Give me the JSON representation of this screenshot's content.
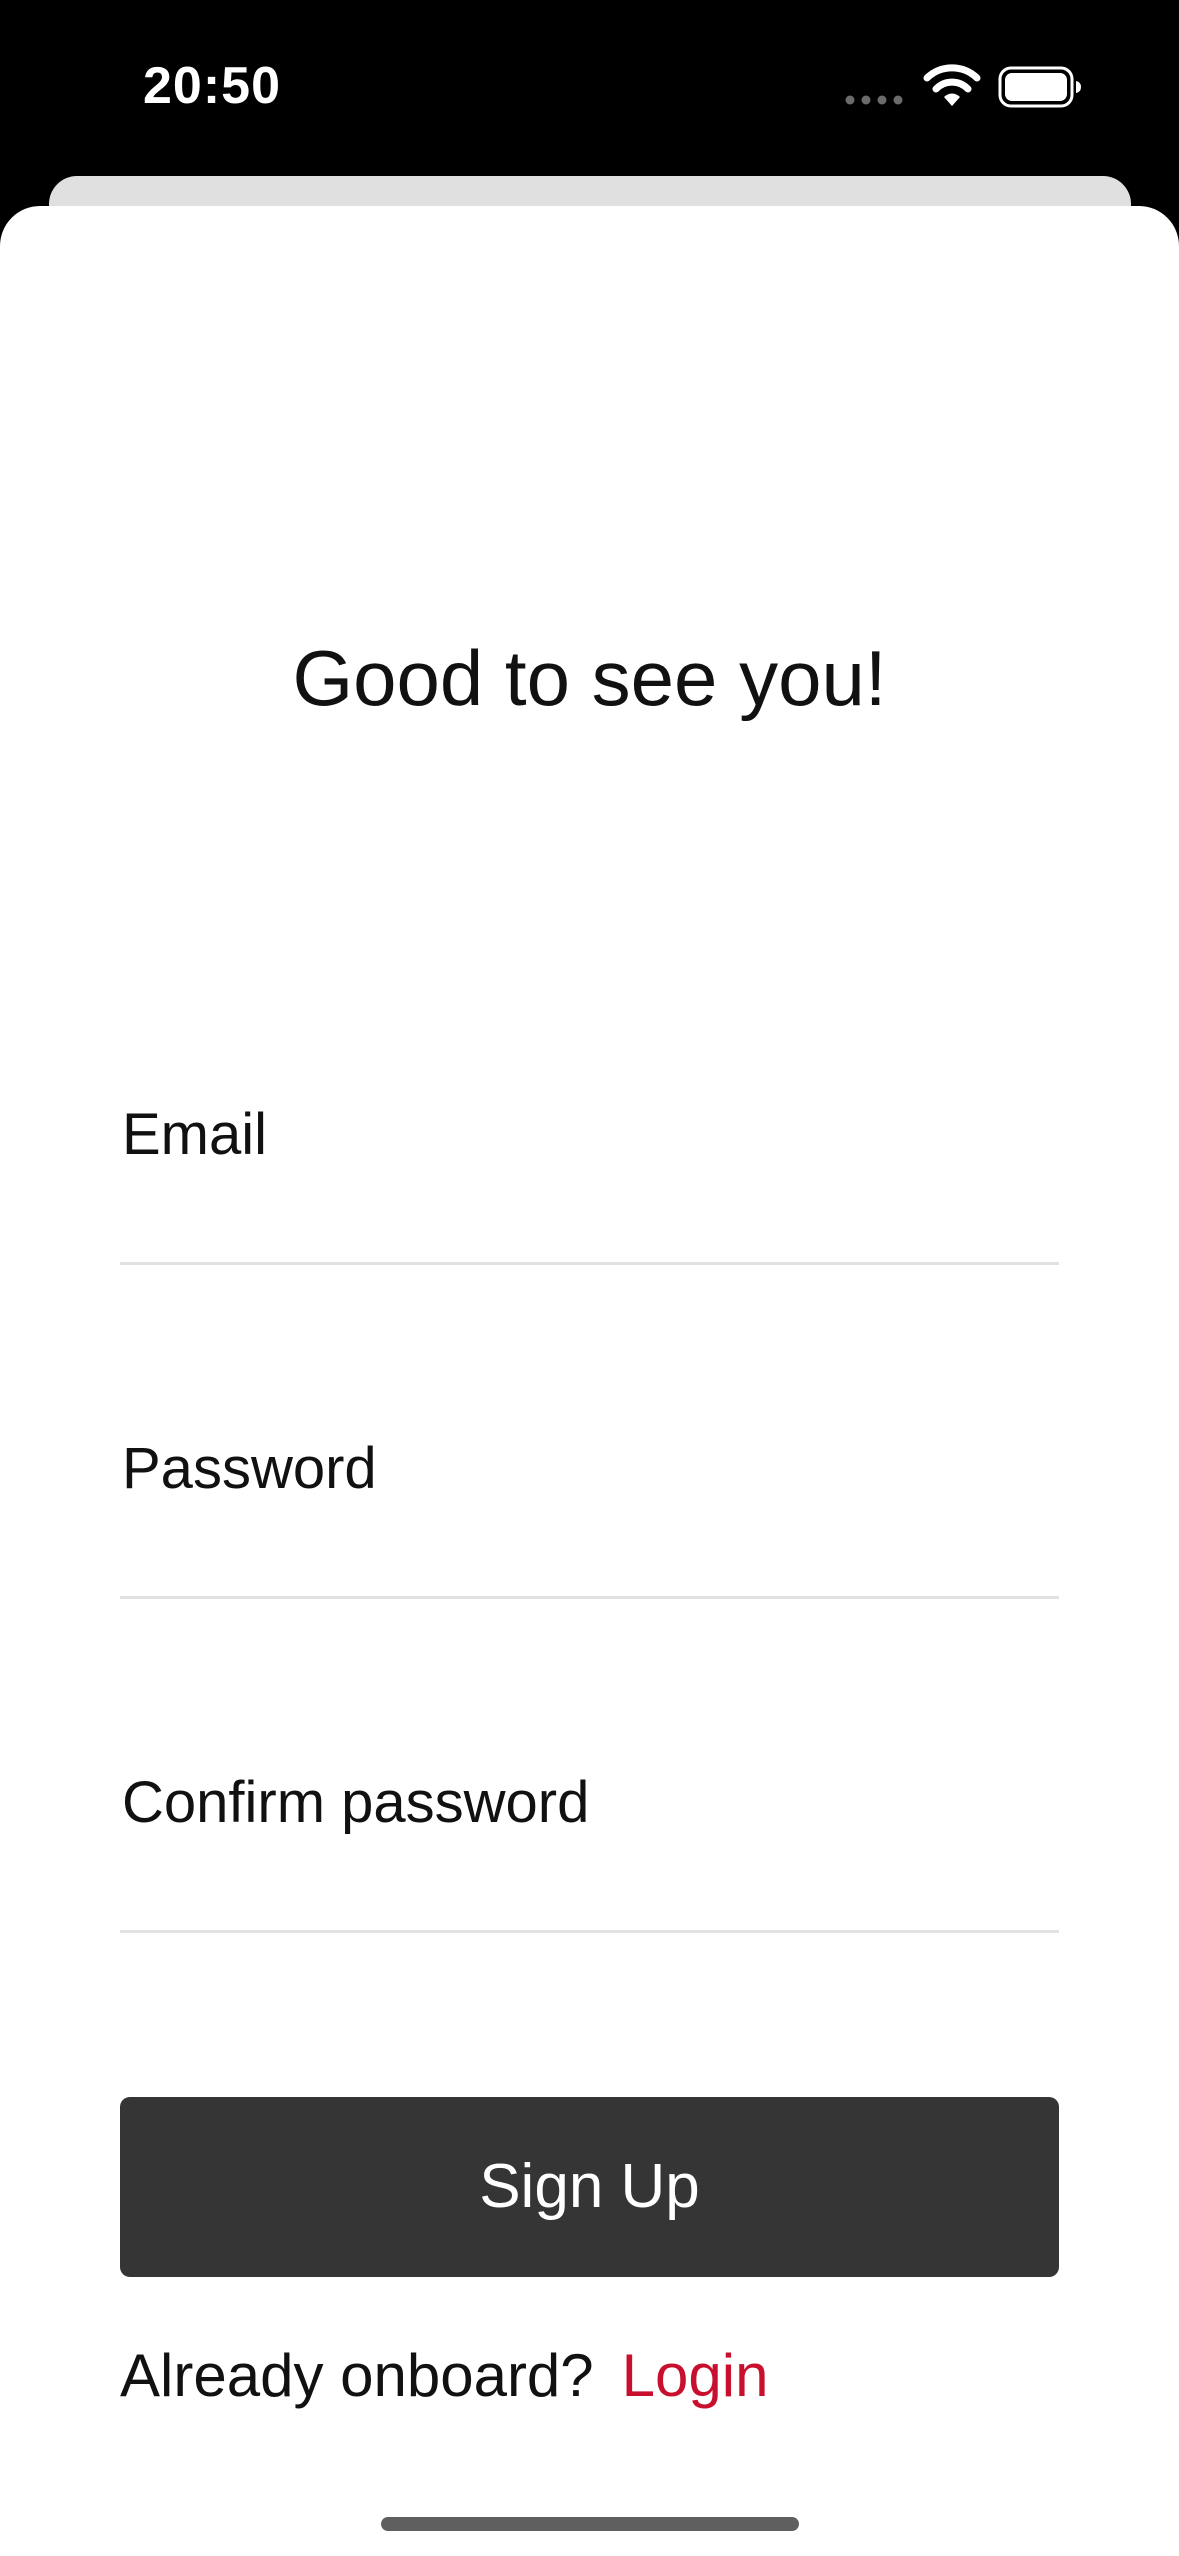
{
  "status_bar": {
    "time": "20:50",
    "icons": [
      "cellular-signal-icon",
      "wifi-icon",
      "battery-icon"
    ]
  },
  "screen": {
    "greeting": "Good to see you!"
  },
  "form": {
    "email_label": "Email",
    "password_label": "Password",
    "confirm_password_label": "Confirm password",
    "email_value": "",
    "password_value": "",
    "confirm_password_value": ""
  },
  "actions": {
    "signup_label": "Sign Up",
    "login_prompt": "Already onboard?",
    "login_link": "Login"
  },
  "colors": {
    "background": "#000000",
    "sheet": "#ffffff",
    "button": "#353535",
    "link": "#c8102e",
    "divider": "#e2e2e2"
  }
}
